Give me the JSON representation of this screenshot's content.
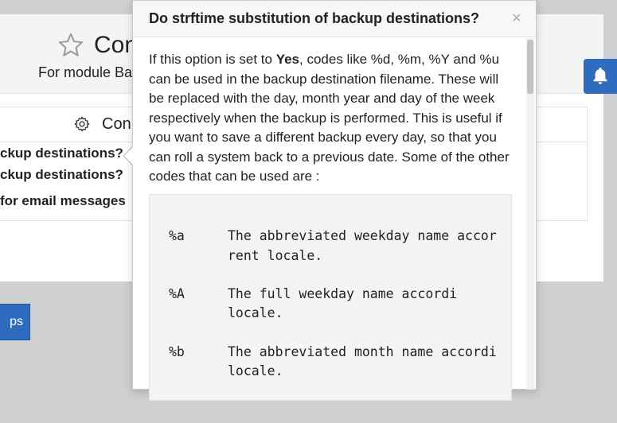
{
  "background": {
    "module_title": "Con",
    "module_subtitle": "For module Ba",
    "table_title": "Con",
    "rows": [
      "ckup destinations?",
      "ckup destinations?",
      "for email messages"
    ],
    "button_label": "ps"
  },
  "popover": {
    "title": "Do strftime substitution of backup destinations?",
    "close_label": "×",
    "intro_before": "If this option is set to ",
    "intro_bold": "Yes",
    "intro_after": ", codes like %d, %m, %Y and %u can be used in the backup destination filename. These will be replaced with the day, month year and day of the week respectively when the backup is performed. This is useful if you want to save a different backup every day, so that you can roll a system back to a previous date. Some of the other codes that can be used are :",
    "codes": [
      {
        "key": "%a",
        "line1": "The abbreviated weekday name accor",
        "line2": "rent locale."
      },
      {
        "key": "%A",
        "line1": "The  full  weekday  name  accordi",
        "line2": "locale."
      },
      {
        "key": "%b",
        "line1": "The abbreviated month name accordi",
        "line2": "locale."
      }
    ]
  },
  "colors": {
    "accent": "#2f6cbf",
    "page_bg": "#cfd0d1"
  }
}
